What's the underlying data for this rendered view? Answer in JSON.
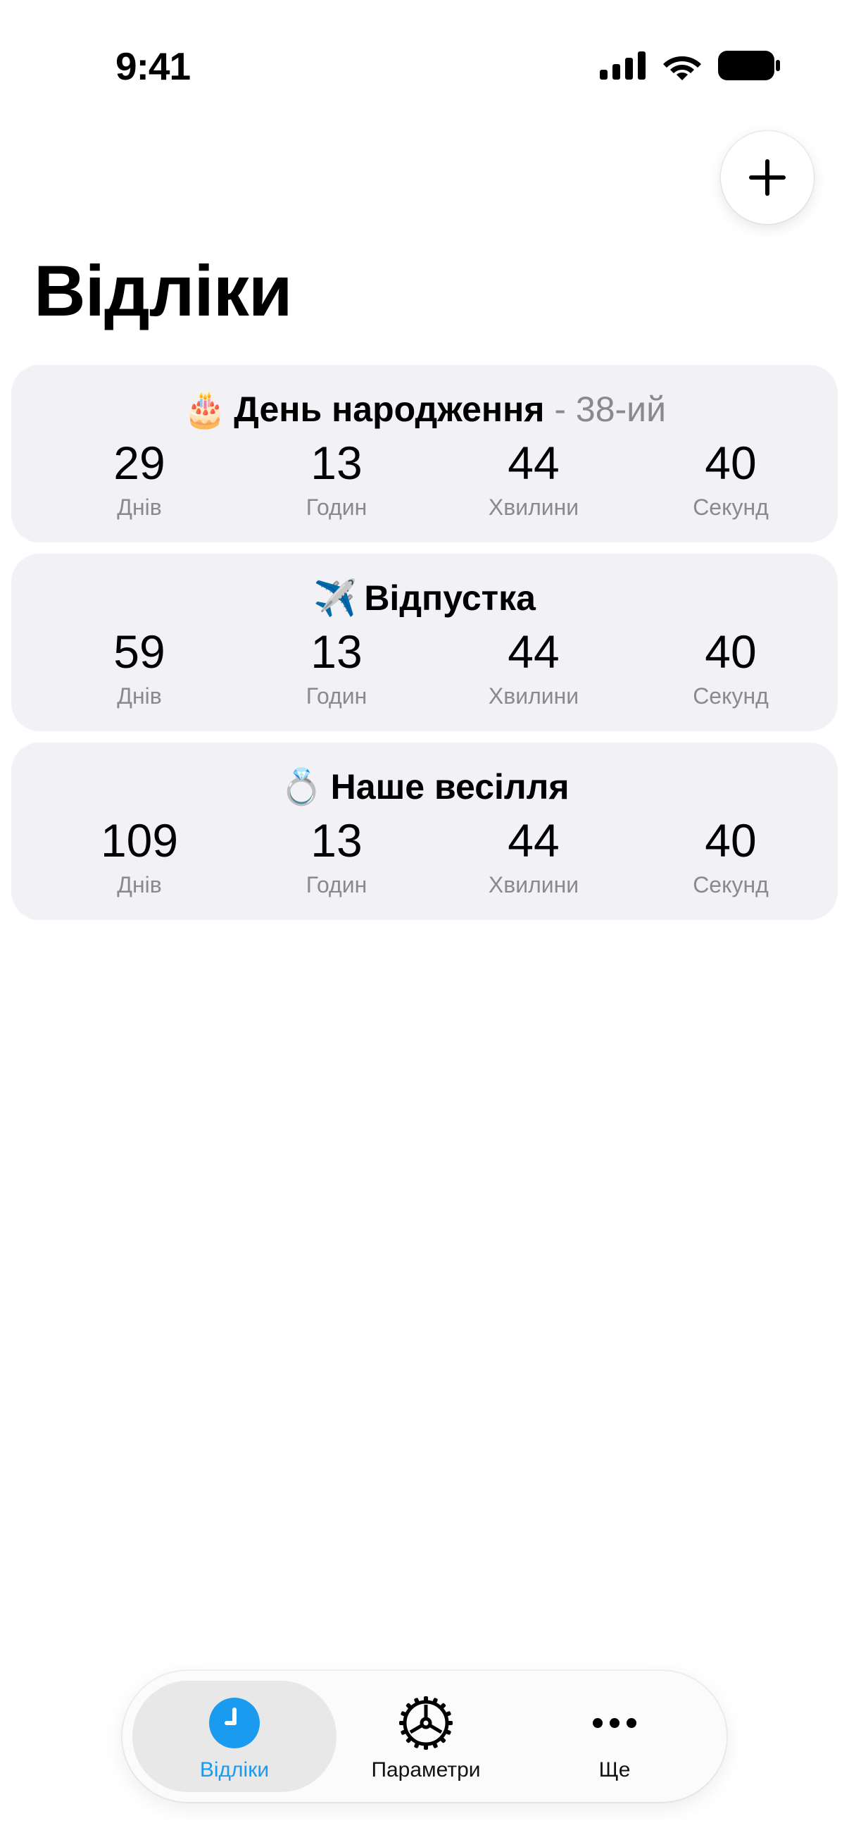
{
  "status_bar": {
    "time": "9:41"
  },
  "header": {
    "title": "Відліки",
    "add_icon": "plus-icon"
  },
  "countdowns": [
    {
      "emoji": "🎂",
      "title": "День народження",
      "suffix": " - 38-ий",
      "days": "29",
      "hours": "13",
      "minutes": "44",
      "seconds": "40"
    },
    {
      "emoji": "✈️",
      "title": "Відпустка",
      "suffix": "",
      "days": "59",
      "hours": "13",
      "minutes": "44",
      "seconds": "40"
    },
    {
      "emoji": "💍",
      "title": "Наше весілля",
      "suffix": "",
      "days": "109",
      "hours": "13",
      "minutes": "44",
      "seconds": "40"
    }
  ],
  "unit_labels": {
    "days": "Днів",
    "hours": "Годин",
    "minutes": "Хвилини",
    "seconds": "Секунд"
  },
  "tab_bar": {
    "tabs": [
      {
        "label": "Відліки",
        "icon": "clock-icon",
        "active": true
      },
      {
        "label": "Параметри",
        "icon": "gear-icon",
        "active": false
      },
      {
        "label": "Ще",
        "icon": "more-icon",
        "active": false
      }
    ]
  },
  "colors": {
    "accent": "#1a9bf0",
    "card_background": "#f2f1f6",
    "secondary_text": "#8a8a8e"
  }
}
